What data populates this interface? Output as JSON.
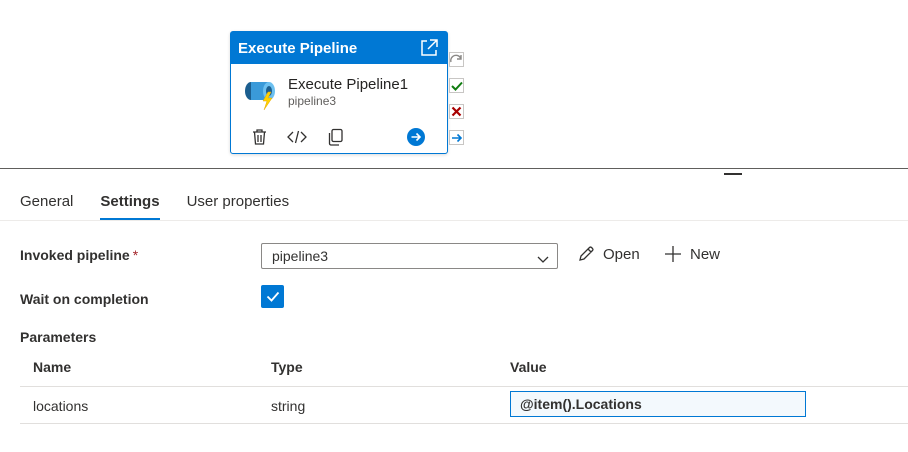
{
  "activity": {
    "header_title": "Execute Pipeline",
    "name": "Execute Pipeline1",
    "subtitle": "pipeline3",
    "icons": {
      "open": "open-in-new-icon",
      "activity": "execute-pipeline-icon",
      "delete": "trash-icon",
      "code": "code-icon",
      "copy": "copy-icon",
      "go": "arrow-right-circle-icon"
    },
    "handles": [
      "skip-icon",
      "success-check-icon",
      "failure-x-icon",
      "completion-arrow-icon"
    ]
  },
  "tabs": [
    {
      "label": "General",
      "active": false
    },
    {
      "label": "Settings",
      "active": true
    },
    {
      "label": "User properties",
      "active": false
    }
  ],
  "form": {
    "invoked_label": "Invoked pipeline",
    "required_mark": "*",
    "invoked_value": "pipeline3",
    "open_label": "Open",
    "new_label": "New",
    "wait_label": "Wait on completion",
    "wait_checked": true,
    "parameters_label": "Parameters"
  },
  "parameters": {
    "headers": [
      "Name",
      "Type",
      "Value"
    ],
    "rows": [
      {
        "name": "locations",
        "type": "string",
        "value": "@item().Locations"
      }
    ]
  },
  "colors": {
    "accent": "#0078d4",
    "success": "#107c10",
    "failure": "#a80000",
    "required": "#a4262c"
  }
}
